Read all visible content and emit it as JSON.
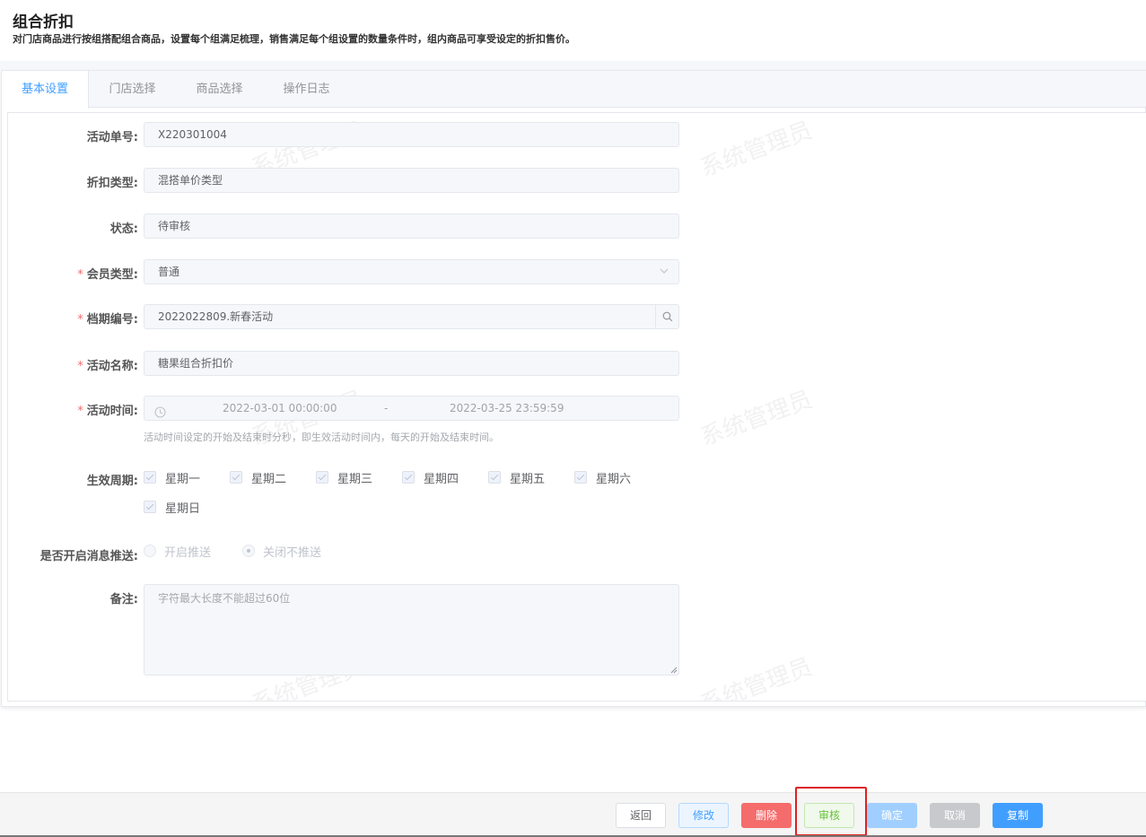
{
  "header": {
    "title": "组合折扣",
    "description": "对门店商品进行按组搭配组合商品，设置每个组满足梳理，销售满足每个组设置的数量条件时，组内商品可享受设定的折扣售价。"
  },
  "tabs": [
    "基本设置",
    "门店选择",
    "商品选择",
    "操作日志"
  ],
  "watermark": "系统管理员",
  "form": {
    "activity_no": {
      "label": "活动单号:",
      "value": "X220301004"
    },
    "discount_type": {
      "label": "折扣类型:",
      "value": "混搭单价类型"
    },
    "status": {
      "label": "状态:",
      "value": "待审核"
    },
    "member_type": {
      "label": "会员类型:",
      "value": "普通",
      "required": "*"
    },
    "period_no": {
      "label": "档期编号:",
      "value": "2022022809.新春活动",
      "required": "*"
    },
    "activity_name": {
      "label": "活动名称:",
      "value": "糖果组合折扣价",
      "required": "*"
    },
    "activity_time": {
      "label": "活动时间:",
      "required": "*",
      "start": "2022-03-01 00:00:00",
      "separator": "-",
      "end": "2022-03-25 23:59:59",
      "hint": "活动时间设定的开始及结束时分秒，即生效活动时间内，每天的开始及结束时间。"
    },
    "effective_cycle": {
      "label": "生效周期:",
      "days": [
        "星期一",
        "星期二",
        "星期三",
        "星期四",
        "星期五",
        "星期六",
        "星期日"
      ]
    },
    "push": {
      "label": "是否开启消息推送:",
      "options": [
        "开启推送",
        "关闭不推送"
      ],
      "selected": "关闭不推送"
    },
    "remark": {
      "label": "备注:",
      "placeholder": "字符最大长度不能超过60位"
    }
  },
  "footer": {
    "back": "返回",
    "edit": "修改",
    "delete": "删除",
    "audit": "审核",
    "confirm": "确定",
    "cancel": "取消",
    "copy": "复制"
  }
}
